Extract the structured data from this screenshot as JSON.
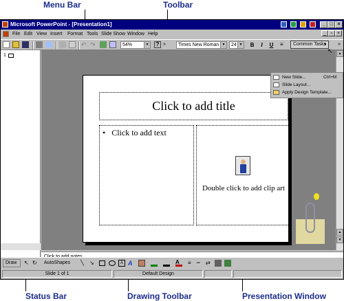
{
  "annotations": {
    "menu_bar": "Menu Bar",
    "toolbar": "Toolbar",
    "status_bar": "Status Bar",
    "drawing_toolbar": "Drawing Toolbar",
    "presentation_window": "Presentation Window"
  },
  "window": {
    "title": "Microsoft PowerPoint - [Presentation1]"
  },
  "menu": {
    "items": [
      "File",
      "Edit",
      "View",
      "Insert",
      "Format",
      "Tools",
      "Slide Show",
      "Window",
      "Help"
    ]
  },
  "toolbar": {
    "zoom": "54%",
    "font": "Times New Roman",
    "size": "24",
    "bold": "B",
    "italic": "I",
    "underline": "U",
    "common_tasks": "Common Tasks"
  },
  "dropdown": {
    "items": [
      {
        "label": "New Slide...",
        "shortcut": "Ctrl+M"
      },
      {
        "label": "Slide Layout...",
        "shortcut": ""
      },
      {
        "label": "Apply Design Template...",
        "shortcut": ""
      }
    ]
  },
  "outline": {
    "slide_number": "1"
  },
  "slide": {
    "title_placeholder": "Click to add title",
    "text_bullet": "•",
    "text_placeholder": "Click to add text",
    "clipart_placeholder": "Double click to add clip art"
  },
  "notes": {
    "placeholder": "Click to add notes"
  },
  "drawing": {
    "draw": "Draw",
    "autoshapes": "AutoShapes"
  },
  "status": {
    "slide": "Slide 1 of 1",
    "design": "Default Design"
  }
}
